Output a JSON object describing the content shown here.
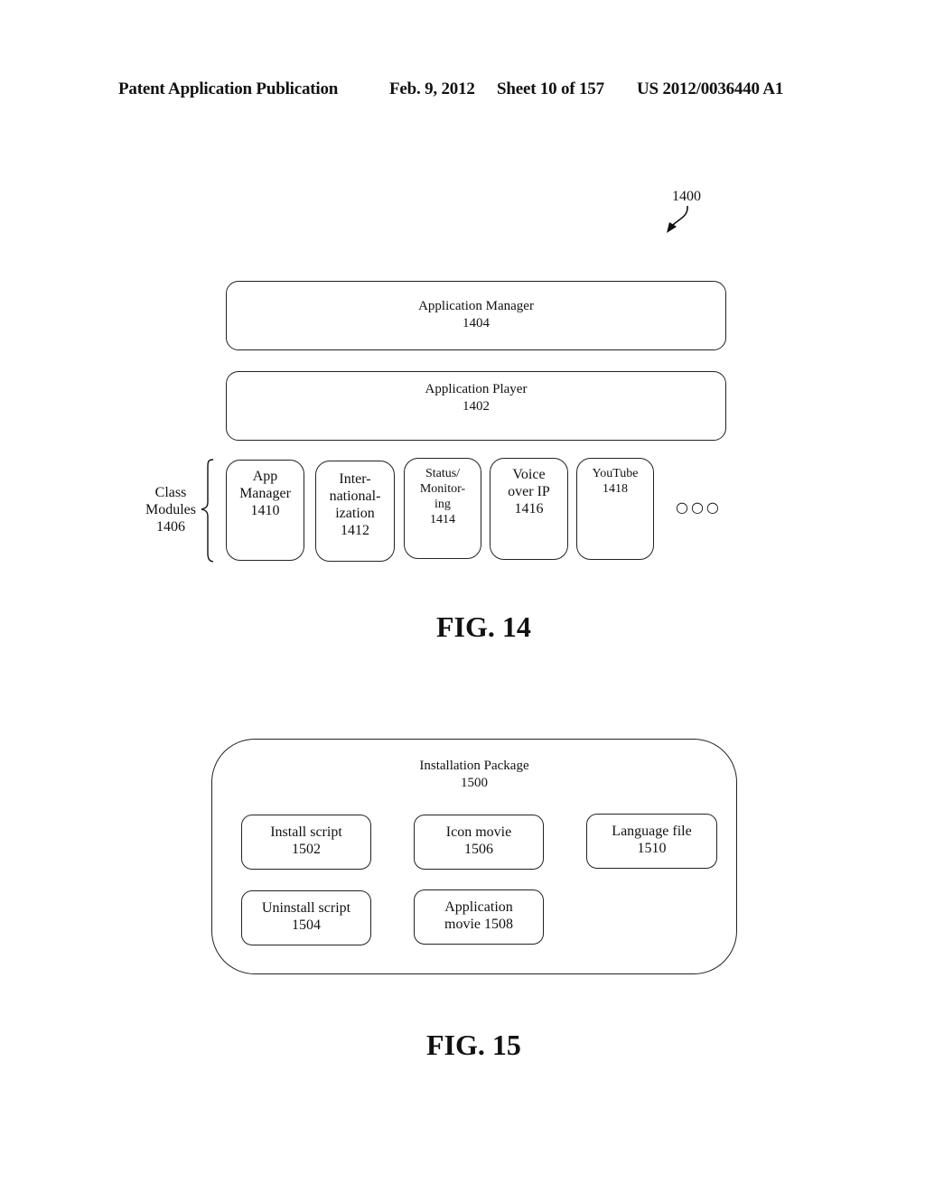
{
  "header": {
    "publication": "Patent Application Publication",
    "date": "Feb. 9, 2012",
    "sheet": "Sheet 10 of 157",
    "number": "US 2012/0036440 A1"
  },
  "fig14": {
    "ref_label": "1400",
    "arrow_icon": "curved-arrow-icon",
    "application_manager": {
      "title": "Application Manager",
      "ref": "1404"
    },
    "application_player": {
      "title": "Application Player",
      "ref": "1402"
    },
    "class_modules": {
      "label_lines": [
        "Class",
        "Modules",
        "1406"
      ],
      "brace_icon": "curly-brace-icon",
      "modules": [
        {
          "lines": [
            "App",
            "Manager",
            "1410"
          ]
        },
        {
          "lines": [
            "Inter-",
            "national-",
            "ization",
            "1412"
          ]
        },
        {
          "lines": [
            "Status/",
            "Monitor-",
            "ing",
            "1414"
          ]
        },
        {
          "lines": [
            "Voice",
            "over IP",
            "1416"
          ]
        },
        {
          "lines": [
            "YouTube",
            "1418"
          ]
        }
      ],
      "ellipsis": "○○○"
    },
    "caption": "FIG. 14"
  },
  "fig15": {
    "package": {
      "title": "Installation Package",
      "ref": "1500"
    },
    "items": [
      {
        "lines": [
          "Install script",
          "1502"
        ]
      },
      {
        "lines": [
          "Icon movie",
          "1506"
        ]
      },
      {
        "lines": [
          "Language file",
          "1510"
        ]
      },
      {
        "lines": [
          "Uninstall script",
          "1504"
        ]
      },
      {
        "lines": [
          "Application",
          "movie 1508"
        ]
      }
    ],
    "caption": "FIG. 15"
  }
}
